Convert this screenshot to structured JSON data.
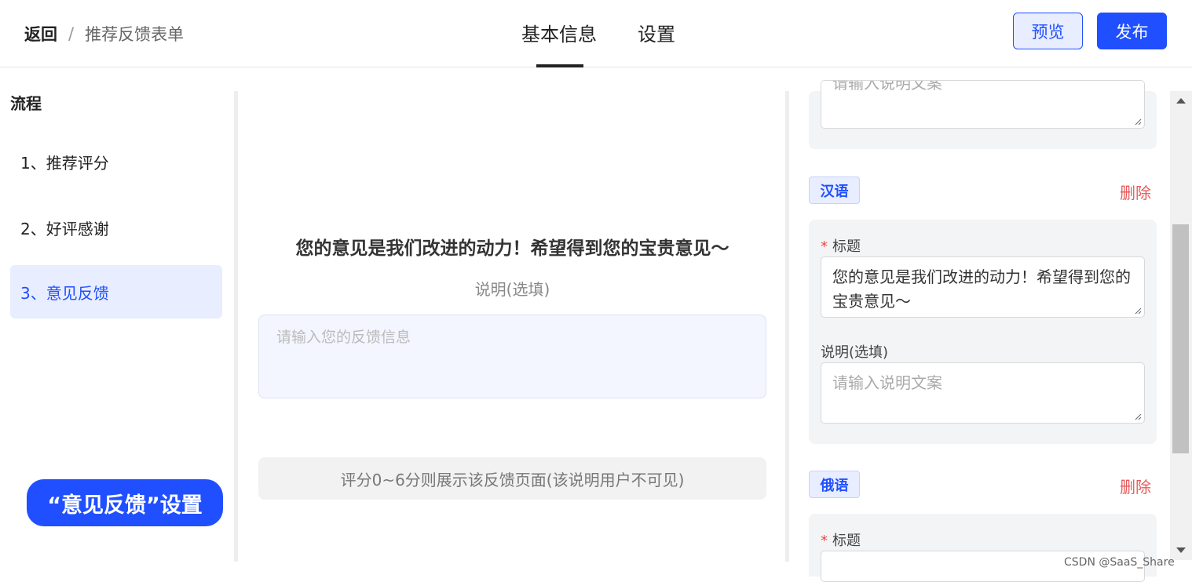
{
  "header": {
    "back_label": "返回",
    "separator": "/",
    "page_title": "推荐反馈表单",
    "tabs": [
      {
        "label": "基本信息",
        "active": true
      },
      {
        "label": "设置",
        "active": false
      }
    ],
    "preview_label": "预览",
    "publish_label": "发布"
  },
  "sidebar": {
    "title": "流程",
    "items": [
      {
        "label": "1、推荐评分"
      },
      {
        "label": "2、好评感谢"
      },
      {
        "label": "3、意见反馈",
        "active": true
      }
    ],
    "setting_badge": "“意见反馈”设置"
  },
  "preview": {
    "title": "您的意见是我们改进的动力！希望得到您的宝贵意见～",
    "description_label": "说明(选填)",
    "feedback_placeholder": "请输入您的反馈信息",
    "note": "评分0~6分则展示该反馈页面(该说明用户不可见)"
  },
  "settings": {
    "top_partial_placeholder": "请输入说明文案",
    "delete_label": "删除",
    "languages": [
      {
        "tag": "汉语",
        "title_label": "标题",
        "title_value": "您的意见是我们改进的动力！希望得到您的宝贵意见～",
        "desc_label": "说明(选填)",
        "desc_placeholder": "请输入说明文案"
      },
      {
        "tag": "俄语",
        "title_label": "标题"
      }
    ]
  },
  "watermark": "CSDN @SaaS_Share",
  "colors": {
    "accent": "#1f4fff",
    "accent_light": "#e8edff",
    "danger": "#e55a5a",
    "panel_bg": "#f3f4f6"
  }
}
